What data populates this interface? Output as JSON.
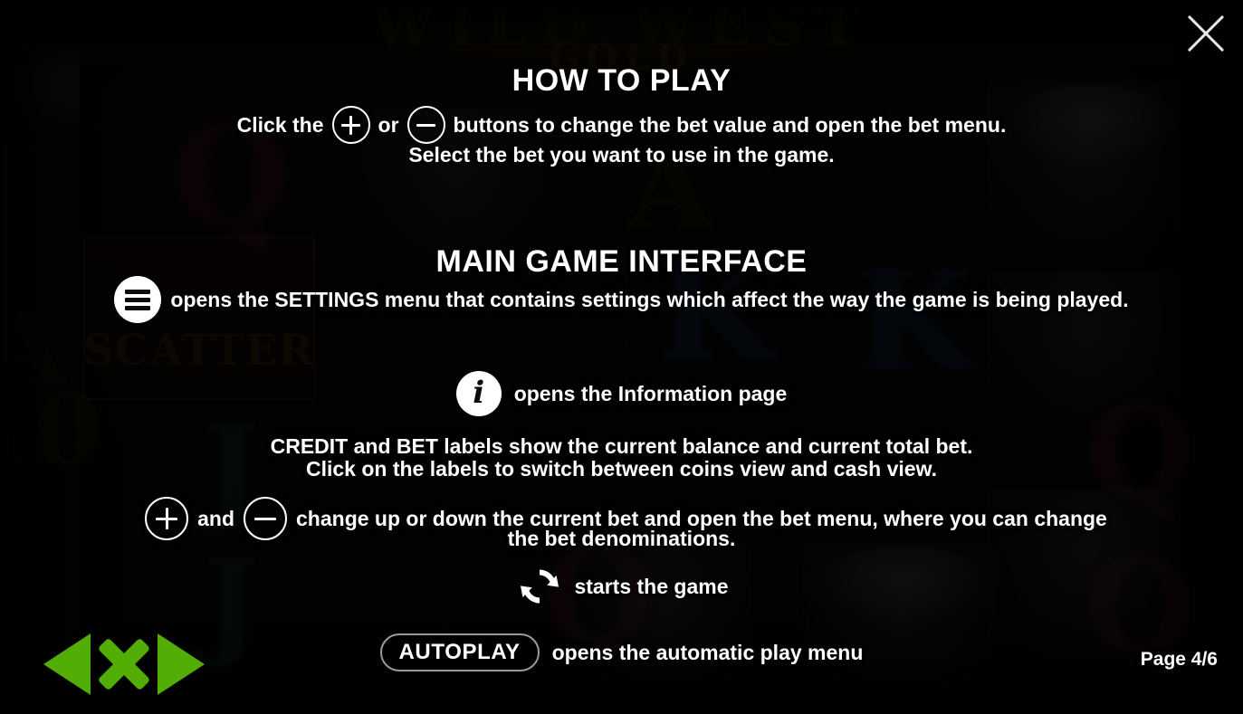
{
  "game": {
    "logo_line1": "WILD WEST",
    "logo_line2": "GOLD",
    "scatter_label": "SCATTER"
  },
  "help": {
    "section1": {
      "title": "HOW TO PLAY",
      "line1_before": "Click the",
      "line1_mid": "or",
      "line1_after": "buttons to change the bet value and open the bet menu.",
      "line2": "Select the bet you want to use in the game."
    },
    "section2": {
      "title": "MAIN GAME INTERFACE",
      "settings_text": "opens the SETTINGS menu that contains settings which affect the way the game is being played.",
      "info_text": "opens the Information page",
      "credit_line1": "CREDIT and BET labels show the current balance and current total bet.",
      "credit_line2": "Click on the labels to switch between coins view and cash view.",
      "bet_before": "and",
      "bet_after": "change up or down the current bet and open the bet menu, where you can change",
      "bet_after2": "the bet denominations.",
      "spin_text": "starts the game",
      "autoplay_label": "AUTOPLAY",
      "autoplay_text": "opens the automatic play menu"
    }
  },
  "footer": {
    "page_indicator": "Page 4/6"
  },
  "icons": {
    "plus": "plus-circle-icon",
    "minus": "minus-circle-icon",
    "menu": "hamburger-menu-icon",
    "info": "info-icon",
    "spin": "spin-refresh-icon",
    "close": "close-icon",
    "prev": "previous-page-icon",
    "next": "next-page-icon",
    "exit": "exit-icon"
  },
  "colors": {
    "accent_green": "#52ae05",
    "text": "#ffffff",
    "background": "#050404",
    "pill_border": "#9a9a9a"
  }
}
